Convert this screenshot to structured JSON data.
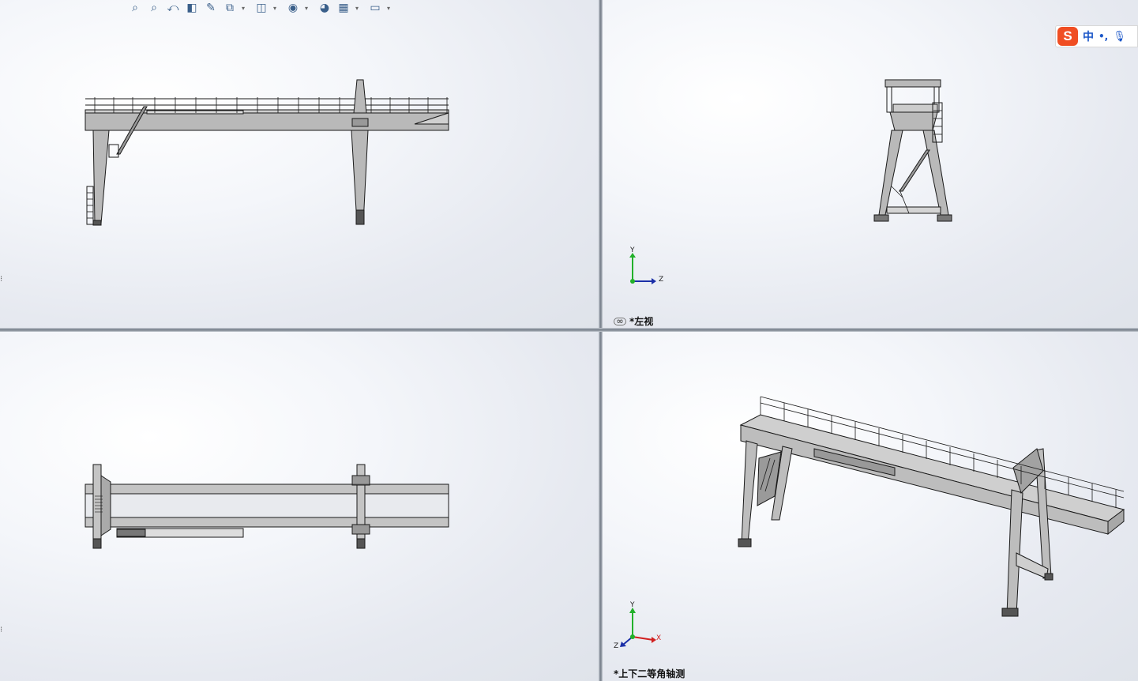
{
  "toolbar": {
    "items": [
      {
        "icon": "zoom-to-fit-icon",
        "glyph": "⌕",
        "dropdown": false
      },
      {
        "icon": "zoom-to-area-icon",
        "glyph": "⌕",
        "dropdown": false
      },
      {
        "icon": "previous-view-icon",
        "glyph": "⤺",
        "dropdown": false
      },
      {
        "icon": "section-view-icon",
        "glyph": "◧",
        "dropdown": false
      },
      {
        "icon": "dynamic-annotation-icon",
        "glyph": "✎",
        "dropdown": false
      },
      {
        "icon": "view-orientation-icon",
        "glyph": "⧉",
        "dropdown": true
      },
      {
        "icon": "display-style-icon",
        "glyph": "◫",
        "dropdown": true
      },
      {
        "icon": "hide-show-items-icon",
        "glyph": "◉",
        "dropdown": true
      },
      {
        "icon": "edit-appearance-icon",
        "glyph": "◕",
        "dropdown": false
      },
      {
        "icon": "apply-scene-icon",
        "glyph": "▦",
        "dropdown": true
      },
      {
        "icon": "view-settings-icon",
        "glyph": "▭",
        "dropdown": true
      }
    ]
  },
  "ime": {
    "logo": "S",
    "lang": "中",
    "punct": "•,",
    "mic_icon": "microphone-icon"
  },
  "viewports": {
    "top_right": {
      "label": "*左视",
      "link_icon": "link-views-icon"
    },
    "bottom_right": {
      "label": "*上下二等角轴测"
    }
  },
  "triad": {
    "y": "Y",
    "z": "Z",
    "x": "X"
  },
  "colors": {
    "y_axis": "#22b02a",
    "z_axis": "#1b2fa8",
    "x_axis": "#d11f1f",
    "steel_face": "#b9b9b9",
    "steel_edge": "#1a1a1a"
  }
}
